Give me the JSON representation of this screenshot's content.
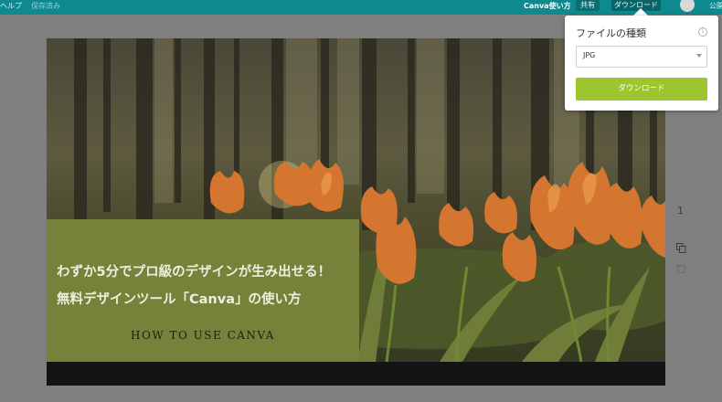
{
  "topbar": {
    "help": "ヘルプ",
    "saved": "保存済み",
    "howto": "Canva使い方",
    "share": "共有",
    "download": "ダウンロード",
    "publish": "公開"
  },
  "design": {
    "title_line1": "わずか5分でプロ級のデザインが生み出せる！",
    "title_line2": "無料デザインツール「Canva」の使い方",
    "subtitle": "HOW TO USE CANVA"
  },
  "sidebar_tools": {
    "page_number": "1"
  },
  "download_popup": {
    "title": "ファイルの種類",
    "file_type_selected": "JPG",
    "download_button": "ダウンロード"
  },
  "colors": {
    "topbar": "#0e8a8e",
    "title_box": "#77813a",
    "download_button": "#9dc52f"
  }
}
